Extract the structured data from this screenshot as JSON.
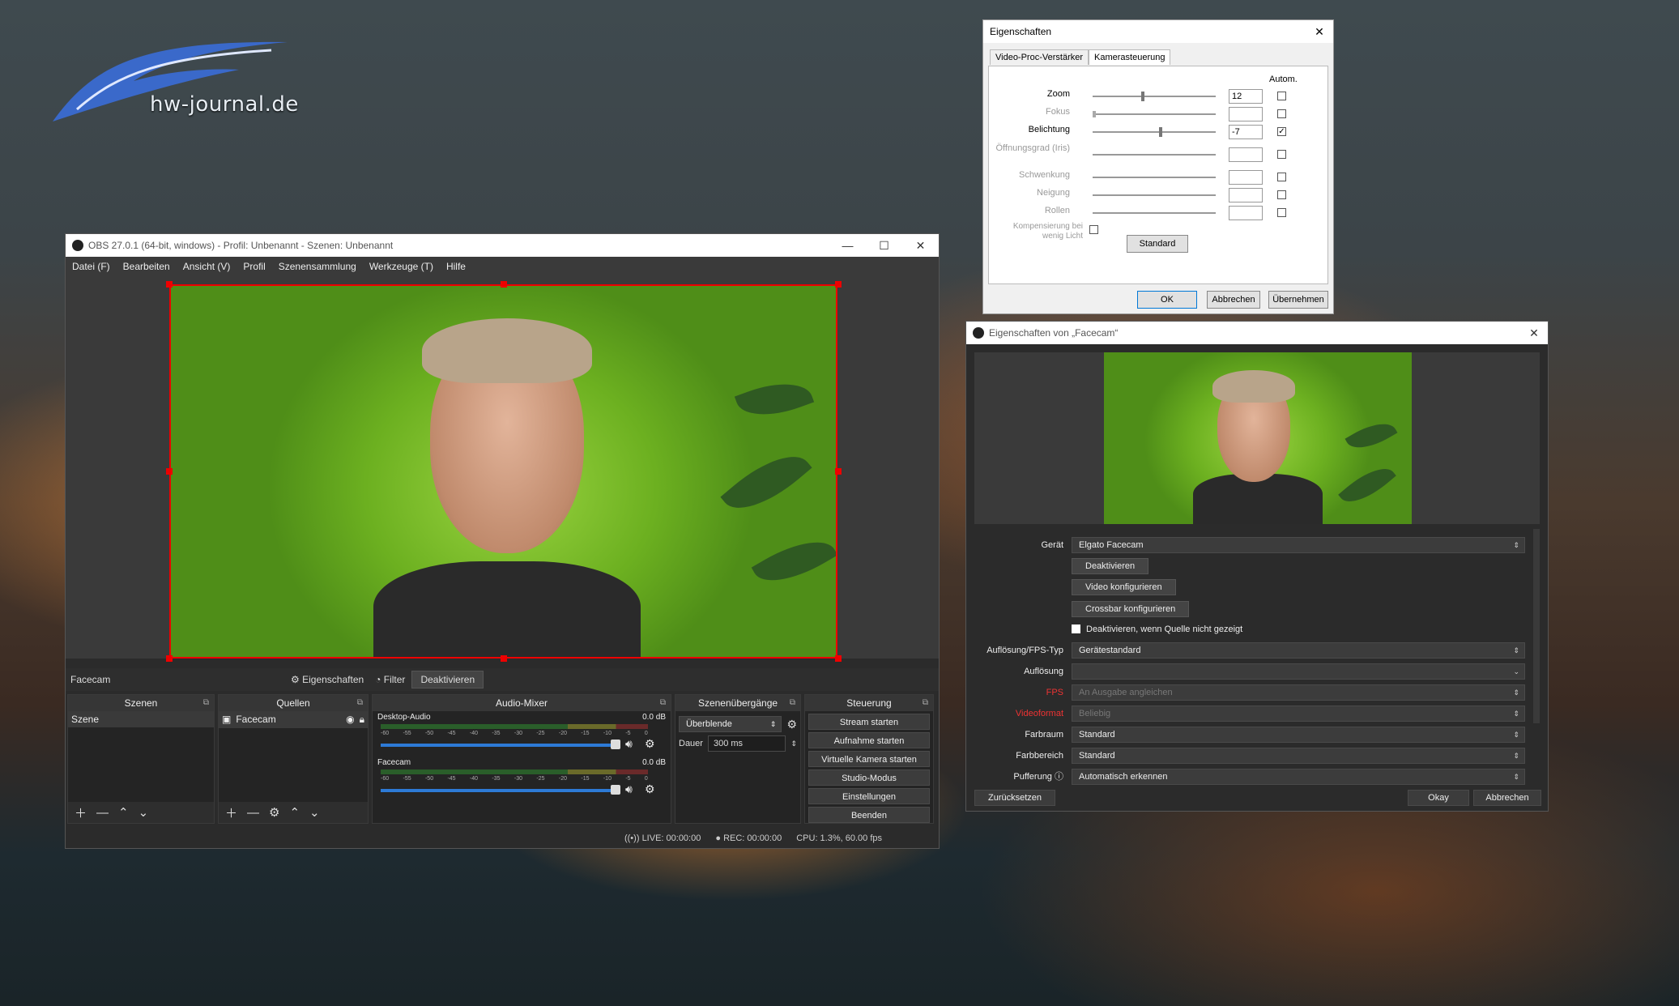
{
  "watermark": {
    "text": "hw-journal.de"
  },
  "obs": {
    "title": "OBS 27.0.1 (64-bit, windows) - Profil: Unbenannt - Szenen: Unbenannt",
    "menu": [
      "Datei (F)",
      "Bearbeiten",
      "Ansicht (V)",
      "Profil",
      "Szenensammlung",
      "Werkzeuge (T)",
      "Hilfe"
    ],
    "sourcebar": {
      "source": "Facecam",
      "properties": "Eigenschaften",
      "filter": "Filter",
      "deactivate": "Deaktivieren"
    },
    "scenes": {
      "header": "Szenen",
      "items": [
        "Szene"
      ]
    },
    "sources": {
      "header": "Quellen",
      "items": [
        "Facecam"
      ]
    },
    "mixer": {
      "header": "Audio-Mixer",
      "channels": [
        {
          "name": "Desktop-Audio",
          "db": "0.0 dB"
        },
        {
          "name": "Facecam",
          "db": "0.0 dB"
        }
      ],
      "ticks": [
        "-60",
        "-55",
        "-50",
        "-45",
        "-40",
        "-35",
        "-30",
        "-25",
        "-20",
        "-15",
        "-10",
        "-5",
        "0"
      ]
    },
    "transitions": {
      "header": "Szenenübergänge",
      "type": "Überblende",
      "duration_label": "Dauer",
      "duration": "300 ms"
    },
    "controls": {
      "header": "Steuerung",
      "buttons": [
        "Stream starten",
        "Aufnahme starten",
        "Virtuelle Kamera starten",
        "Studio-Modus",
        "Einstellungen",
        "Beenden"
      ]
    },
    "status": {
      "live": "LIVE: 00:00:00",
      "rec": "REC: 00:00:00",
      "cpu": "CPU: 1.3%, 60.00 fps"
    }
  },
  "props": {
    "title": "Eigenschaften",
    "tabs": [
      "Video-Proc-Verstärker",
      "Kamerasteuerung"
    ],
    "autom": "Autom.",
    "rows": [
      {
        "label": "Zoom",
        "value": "12",
        "checked": false,
        "enabled": true
      },
      {
        "label": "Fokus",
        "value": "",
        "checked": false,
        "enabled": false
      },
      {
        "label": "Belichtung",
        "value": "-7",
        "checked": true,
        "enabled": true
      },
      {
        "label": "Öffnungsgrad (Iris)",
        "value": "",
        "checked": false,
        "enabled": false
      },
      {
        "label": "Schwenkung",
        "value": "",
        "checked": false,
        "enabled": false
      },
      {
        "label": "Neigung",
        "value": "",
        "checked": false,
        "enabled": false
      },
      {
        "label": "Rollen",
        "value": "",
        "checked": false,
        "enabled": false
      }
    ],
    "lowlight": "Kompensierung bei wenig Licht",
    "standard": "Standard",
    "ok": "OK",
    "cancel": "Abbrechen",
    "apply": "Übernehmen"
  },
  "facecam": {
    "title": "Eigenschaften von „Facecam“",
    "device_label": "Gerät",
    "device": "Elgato Facecam",
    "btn_deactivate": "Deaktivieren",
    "btn_video": "Video konfigurieren",
    "btn_crossbar": "Crossbar konfigurieren",
    "checkbox": "Deaktivieren, wenn Quelle nicht gezeigt",
    "rows": [
      {
        "label": "Auflösung/FPS-Typ",
        "value": "Gerätestandard"
      },
      {
        "label": "Auflösung",
        "value": ""
      },
      {
        "label": "FPS",
        "value": "An Ausgabe angleichen"
      },
      {
        "label": "Videoformat",
        "value": "Beliebig"
      },
      {
        "label": "Farbraum",
        "value": "Standard"
      },
      {
        "label": "Farbbereich",
        "value": "Standard"
      },
      {
        "label": "Pufferung",
        "value": "Automatisch erkennen"
      }
    ],
    "reset": "Zurücksetzen",
    "okay": "Okay",
    "cancel": "Abbrechen"
  }
}
